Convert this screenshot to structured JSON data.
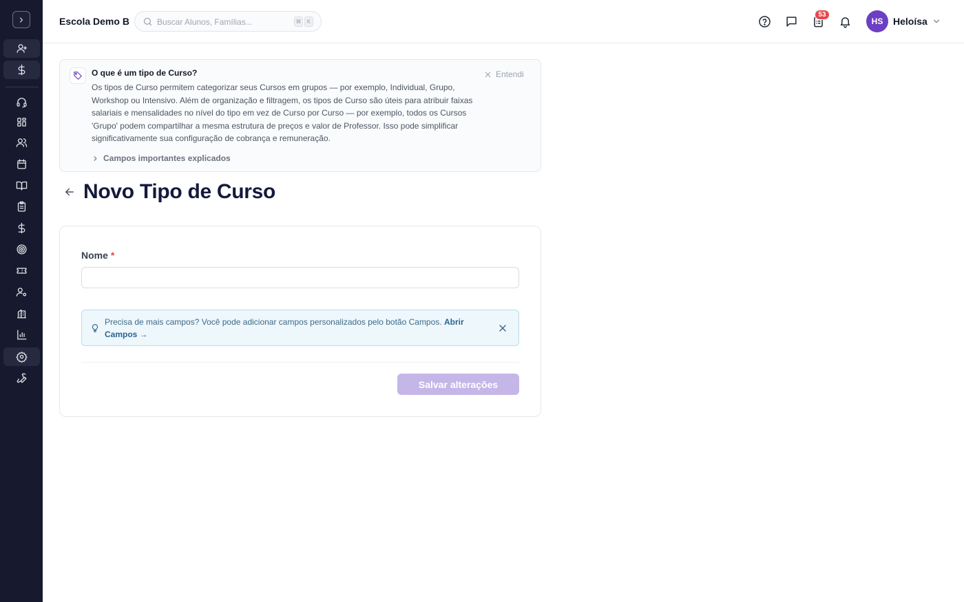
{
  "topbar": {
    "school_name": "Escola Demo B",
    "search_placeholder": "Buscar Alunos, Famílias...",
    "shortcut_keys": [
      "⌘",
      "K"
    ],
    "tasks_badge": "53",
    "user_initials": "HS",
    "user_name": "Heloísa"
  },
  "sidebar": {
    "toggle_icon": "chevron-right-icon",
    "items": [
      {
        "icon": "user-plus-icon"
      },
      {
        "icon": "dollar-icon"
      },
      {
        "icon": "headset-icon"
      },
      {
        "icon": "dashboard-icon"
      },
      {
        "icon": "users-icon"
      },
      {
        "icon": "calendar-icon"
      },
      {
        "icon": "book-open-icon"
      },
      {
        "icon": "clipboard-icon"
      },
      {
        "icon": "dollar-icon"
      },
      {
        "icon": "target-icon"
      },
      {
        "icon": "ticket-icon"
      },
      {
        "icon": "user-cog-icon"
      },
      {
        "icon": "building-icon"
      },
      {
        "icon": "bar-chart-icon"
      },
      {
        "icon": "settings-icon",
        "active": true
      },
      {
        "icon": "wrench-icon"
      }
    ]
  },
  "banner": {
    "title": "O que é um tipo de Curso?",
    "body": "Os tipos de Curso permitem categorizar seus Cursos em grupos — por exemplo, Individual, Grupo, Workshop ou Intensivo. Além de organização e filtragem, os tipos de Curso são úteis para atribuir faixas salariais e mensalidades no nível do tipo em vez de Curso por Curso — por exemplo, todos os Cursos 'Grupo' podem compartilhar a mesma estrutura de preços e valor de Professor. Isso pode simplificar significativamente sua configuração de cobrança e remuneração.",
    "dismiss_label": "Entendi",
    "expand_label": "Campos importantes explicados"
  },
  "page": {
    "title": "Novo Tipo de Curso"
  },
  "form": {
    "name_label": "Nome",
    "required_mark": "*",
    "name_value": "",
    "tip_text": "Precisa de mais campos? Você pode adicionar campos personalizados pelo botão Campos.",
    "tip_link": "Abrir Campos →",
    "save_label": "Salvar alterações",
    "save_disabled": true
  },
  "colors": {
    "sidebar_bg": "#171a2e",
    "accent": "#6d3fc4",
    "save_disabled_bg": "#c5b6e8",
    "badge": "#e5484d",
    "title": "#141a3d"
  }
}
